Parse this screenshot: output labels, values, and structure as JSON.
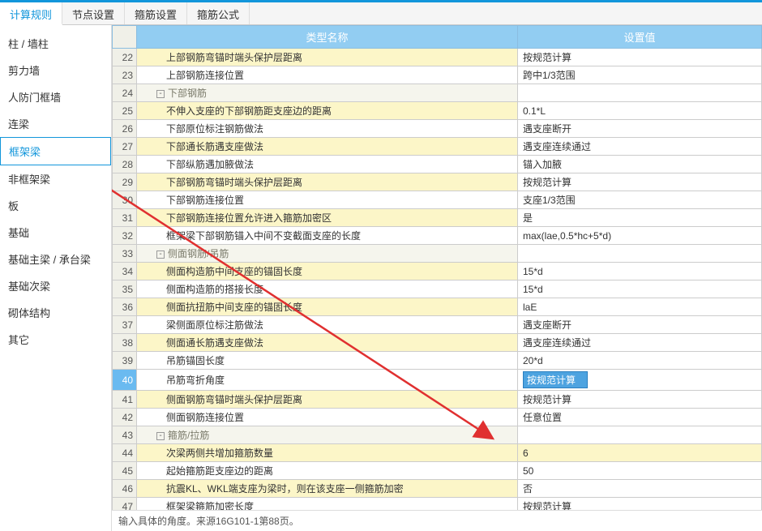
{
  "tabs": {
    "t0": "计算规则",
    "t1": "节点设置",
    "t2": "箍筋设置",
    "t3": "箍筋公式"
  },
  "sidebar": {
    "items": [
      {
        "label": "柱 / 墙柱"
      },
      {
        "label": "剪力墙"
      },
      {
        "label": "人防门框墙"
      },
      {
        "label": "连梁"
      },
      {
        "label": "框架梁"
      },
      {
        "label": "非框架梁"
      },
      {
        "label": "板"
      },
      {
        "label": "基础"
      },
      {
        "label": "基础主梁 / 承台梁"
      },
      {
        "label": "基础次梁"
      },
      {
        "label": "砌体结构"
      },
      {
        "label": "其它"
      }
    ]
  },
  "cols": {
    "name": "类型名称",
    "val": "设置值"
  },
  "rows": [
    {
      "n": "22",
      "name": "上部钢筋弯锚时端头保护层距离",
      "val": "按规范计算",
      "cls": "yellow",
      "ind": 2
    },
    {
      "n": "23",
      "name": "上部钢筋连接位置",
      "val": "跨中1/3范围",
      "cls": "",
      "ind": 2
    },
    {
      "n": "24",
      "name": "下部钢筋",
      "val": "",
      "cls": "group",
      "ind": 1,
      "tg": "-"
    },
    {
      "n": "25",
      "name": "不伸入支座的下部钢筋距支座边的距离",
      "val": "0.1*L",
      "cls": "yellow",
      "ind": 2
    },
    {
      "n": "26",
      "name": "下部原位标注钢筋做法",
      "val": "遇支座断开",
      "cls": "",
      "ind": 2
    },
    {
      "n": "27",
      "name": "下部通长筋遇支座做法",
      "val": "遇支座连续通过",
      "cls": "yellow",
      "ind": 2
    },
    {
      "n": "28",
      "name": "下部纵筋遇加腋做法",
      "val": "锚入加腋",
      "cls": "",
      "ind": 2
    },
    {
      "n": "29",
      "name": "下部钢筋弯锚时端头保护层距离",
      "val": "按规范计算",
      "cls": "yellow",
      "ind": 2
    },
    {
      "n": "30",
      "name": "下部钢筋连接位置",
      "val": "支座1/3范围",
      "cls": "",
      "ind": 2
    },
    {
      "n": "31",
      "name": "下部钢筋连接位置允许进入箍筋加密区",
      "val": "是",
      "cls": "yellow",
      "ind": 2
    },
    {
      "n": "32",
      "name": "框架梁下部钢筋锚入中间不变截面支座的长度",
      "val": "max(lae,0.5*hc+5*d)",
      "cls": "",
      "ind": 2
    },
    {
      "n": "33",
      "name": "侧面钢筋/吊筋",
      "val": "",
      "cls": "group",
      "ind": 1,
      "tg": "-"
    },
    {
      "n": "34",
      "name": "侧面构造筋中间支座的锚固长度",
      "val": "15*d",
      "cls": "yellow",
      "ind": 2
    },
    {
      "n": "35",
      "name": "侧面构造筋的搭接长度",
      "val": "15*d",
      "cls": "",
      "ind": 2
    },
    {
      "n": "36",
      "name": "侧面抗扭筋中间支座的锚固长度",
      "val": "laE",
      "cls": "yellow",
      "ind": 2
    },
    {
      "n": "37",
      "name": "梁侧面原位标注筋做法",
      "val": "遇支座断开",
      "cls": "",
      "ind": 2
    },
    {
      "n": "38",
      "name": "侧面通长筋遇支座做法",
      "val": "遇支座连续通过",
      "cls": "yellow",
      "ind": 2
    },
    {
      "n": "39",
      "name": "吊筋锚固长度",
      "val": "20*d",
      "cls": "",
      "ind": 2
    },
    {
      "n": "40",
      "name": "吊筋弯折角度",
      "val": "按规范计算",
      "cls": "highlight-row",
      "ind": 2,
      "editing": true
    },
    {
      "n": "41",
      "name": "侧面钢筋弯锚时端头保护层距离",
      "val": "按规范计算",
      "cls": "yellow",
      "ind": 2
    },
    {
      "n": "42",
      "name": "侧面钢筋连接位置",
      "val": "任意位置",
      "cls": "",
      "ind": 2
    },
    {
      "n": "43",
      "name": "箍筋/拉筋",
      "val": "",
      "cls": "group",
      "ind": 1,
      "tg": "-"
    },
    {
      "n": "44",
      "name": "次梁两侧共增加箍筋数量",
      "val": "6",
      "cls": "yellowall",
      "ind": 2
    },
    {
      "n": "45",
      "name": "起始箍筋距支座边的距离",
      "val": "50",
      "cls": "",
      "ind": 2
    },
    {
      "n": "46",
      "name": "抗震KL、WKL端支座为梁时，则在该支座一侧箍筋加密",
      "val": "否",
      "cls": "yellow",
      "ind": 2
    },
    {
      "n": "47",
      "name": "框架梁箍筋加密长度",
      "val": "按规范计算",
      "cls": "",
      "ind": 2
    }
  ],
  "footer": "输入具体的角度。来源16G101-1第88页。"
}
